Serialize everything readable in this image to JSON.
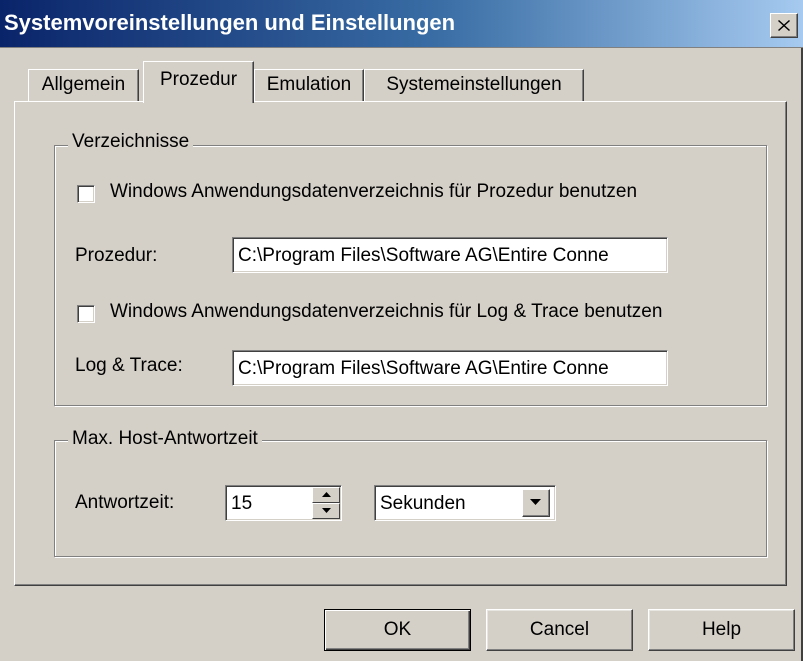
{
  "window": {
    "title": "Systemvoreinstellungen und Einstellungen",
    "close_icon": "close-icon"
  },
  "tabs": [
    {
      "label": "Allgemein",
      "active": false
    },
    {
      "label": "Prozedur",
      "active": true
    },
    {
      "label": "Emulation",
      "active": false
    },
    {
      "label": "Systemeinstellungen",
      "active": false
    }
  ],
  "directories": {
    "group_label": "Verzeichnisse",
    "use_appdata_procedure": {
      "label": "Windows Anwendungsdatenverzeichnis für Prozedur benutzen",
      "checked": false
    },
    "procedure": {
      "label": "Prozedur:",
      "value": "C:\\Program Files\\Software AG\\Entire Conne"
    },
    "use_appdata_logtrace": {
      "label": "Windows Anwendungsdatenverzeichnis für Log & Trace benutzen",
      "checked": false
    },
    "logtrace": {
      "label": "Log & Trace:",
      "value": "C:\\Program Files\\Software AG\\Entire Conne"
    }
  },
  "response_time": {
    "group_label": "Max. Host-Antwortzeit",
    "label": "Antwortzeit:",
    "value": "15",
    "unit": "Sekunden"
  },
  "buttons": {
    "ok": "OK",
    "cancel": "Cancel",
    "help": "Help"
  }
}
